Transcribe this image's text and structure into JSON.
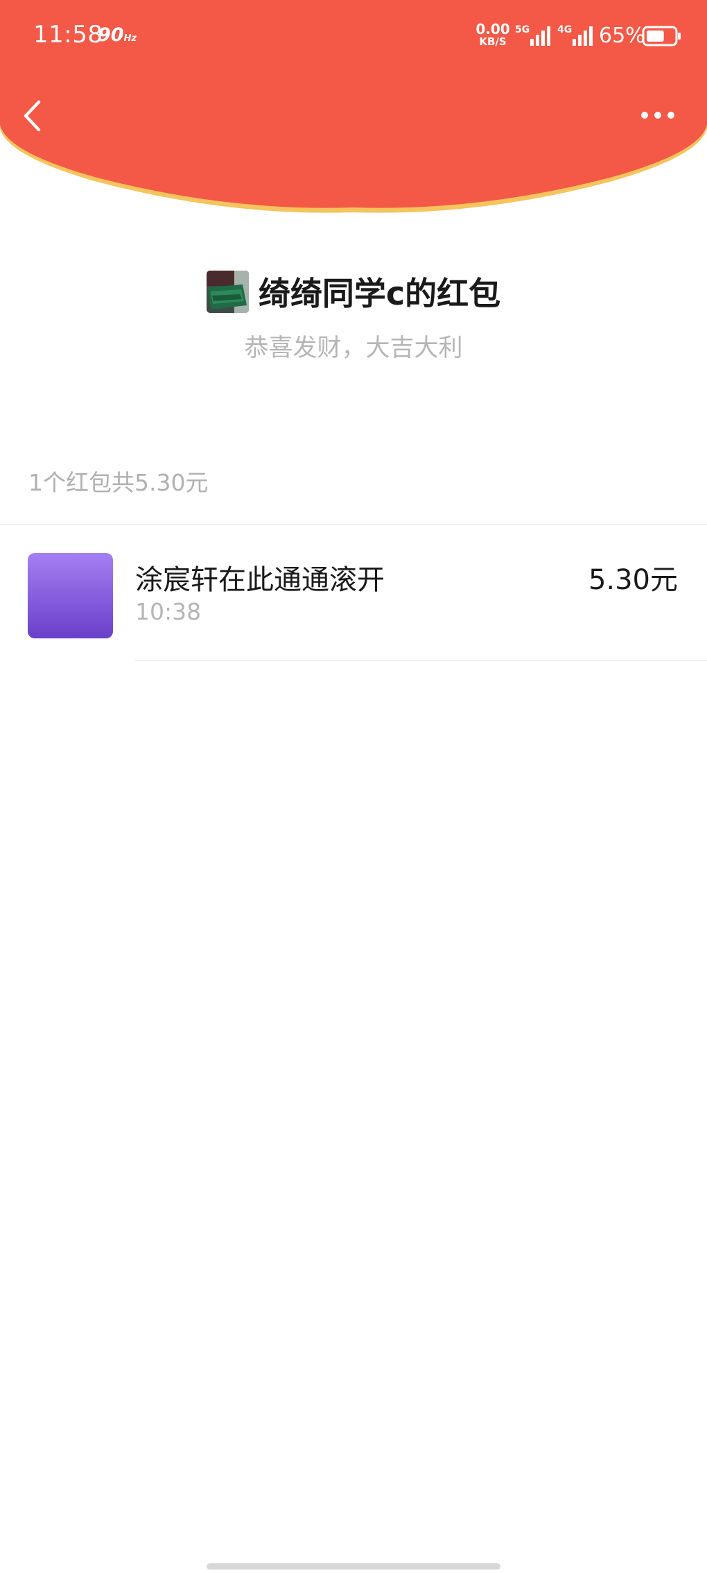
{
  "status_bar": {
    "time": "11:58",
    "refresh_rate": "90",
    "refresh_rate_unit": "Hz",
    "net_speed_value": "0.00",
    "net_speed_unit": "KB/S",
    "network_1": "5G",
    "network_2": "4G",
    "battery_percent": "65%",
    "battery_level": 0.65
  },
  "nav": {
    "back_icon": "chevron-left-icon",
    "more_icon": "more-dots-icon"
  },
  "colors": {
    "header_red": "#f45846",
    "header_border": "#f5c45d",
    "record_avatar_top": "#a57ff3",
    "record_avatar_bottom": "#6a3fc8"
  },
  "packet": {
    "sender_title": "绮绮同学c的红包",
    "greeting": "恭喜发财，大吉大利",
    "summary": "1个红包共5.30元"
  },
  "records": [
    {
      "name": "涂宸轩在此通通滚开",
      "time": "10:38",
      "amount": "5.30元"
    }
  ]
}
